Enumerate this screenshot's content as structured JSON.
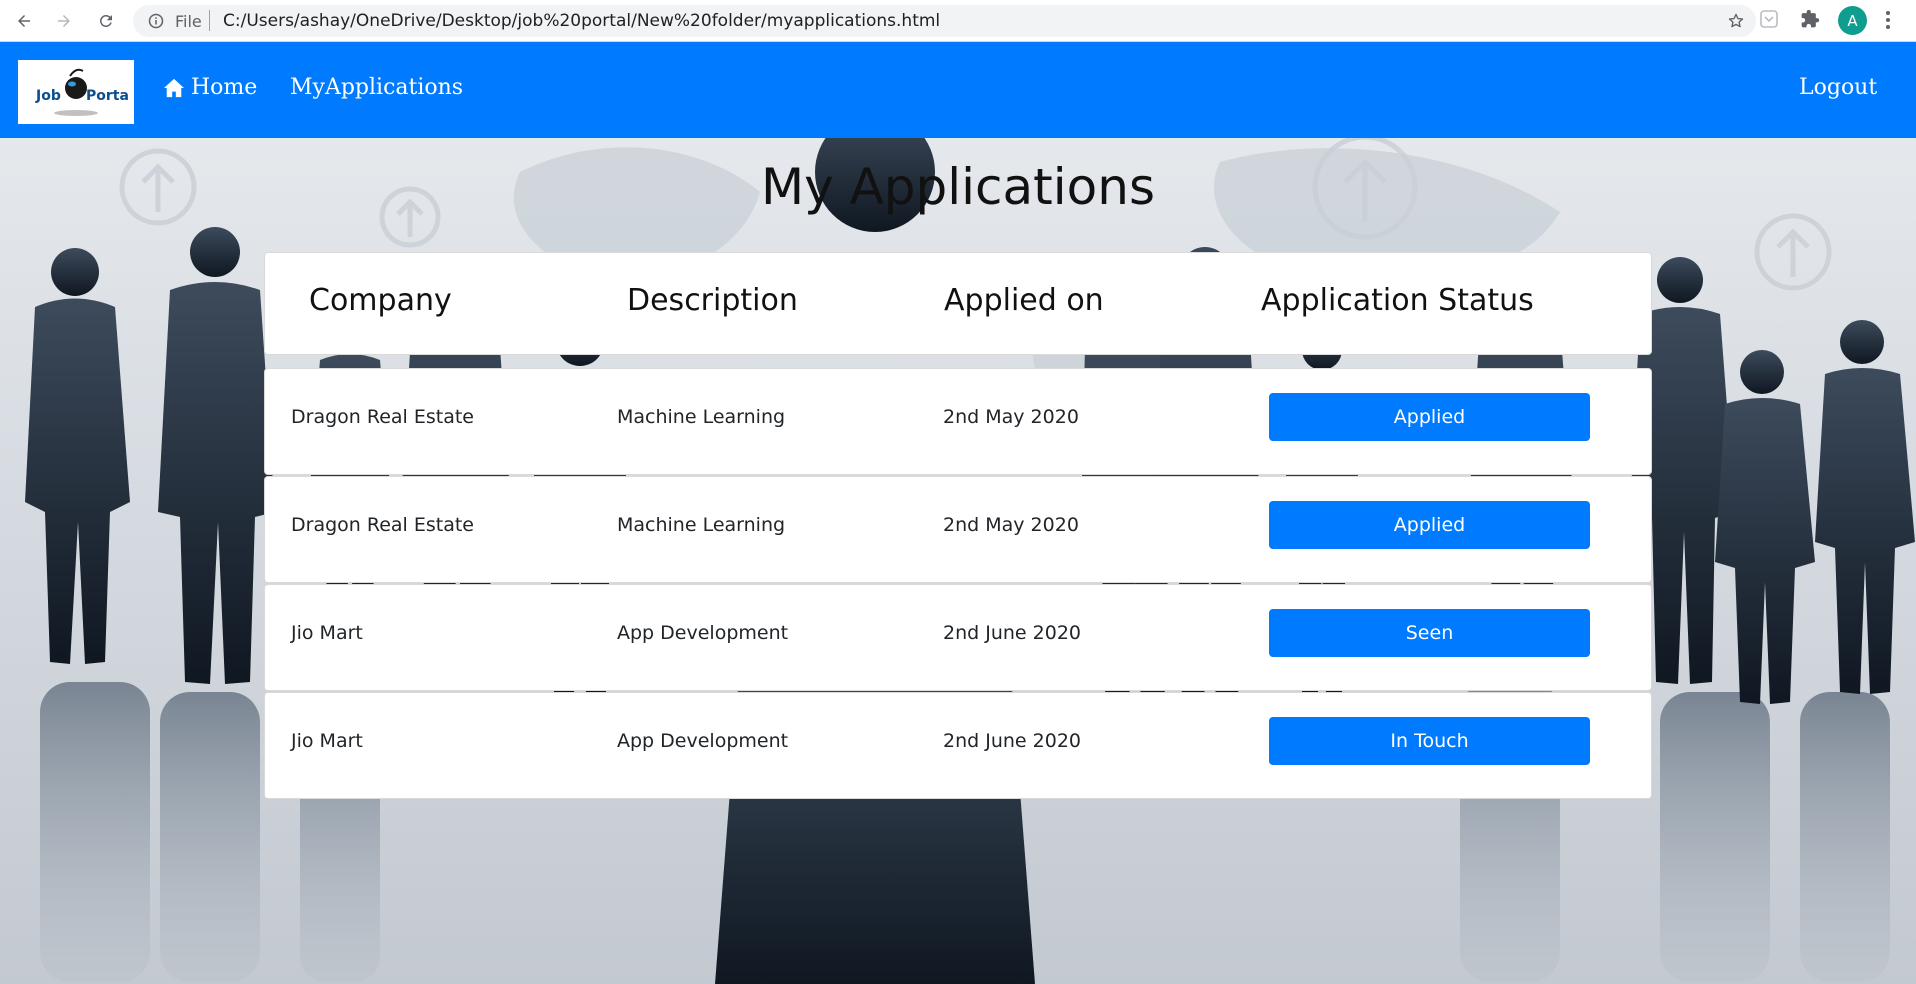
{
  "browser": {
    "scheme_label": "File",
    "url": "C:/Users/ashay/OneDrive/Desktop/job%20portal/New%20folder/myapplications.html",
    "profile_initial": "A"
  },
  "navbar": {
    "logo_text_left": "Job",
    "logo_text_right": "Portal",
    "home_label": "Home",
    "myapps_label": "MyApplications",
    "logout_label": "Logout"
  },
  "page": {
    "title": "My Applications"
  },
  "table": {
    "headers": [
      "Company",
      "Description",
      "Applied on",
      "Application Status"
    ],
    "rows": [
      {
        "company": "Dragon Real Estate",
        "description": "Machine Learning",
        "applied_on": "2nd May 2020",
        "status": "Applied"
      },
      {
        "company": "Dragon Real Estate",
        "description": "Machine Learning",
        "applied_on": "2nd May 2020",
        "status": "Applied"
      },
      {
        "company": "Jio Mart",
        "description": "App Development",
        "applied_on": "2nd June 2020",
        "status": "Seen"
      },
      {
        "company": "Jio Mart",
        "description": "App Development",
        "applied_on": "2nd June 2020",
        "status": "In Touch"
      }
    ]
  },
  "colors": {
    "primary": "#007bff",
    "avatar": "#0f9d8f"
  }
}
